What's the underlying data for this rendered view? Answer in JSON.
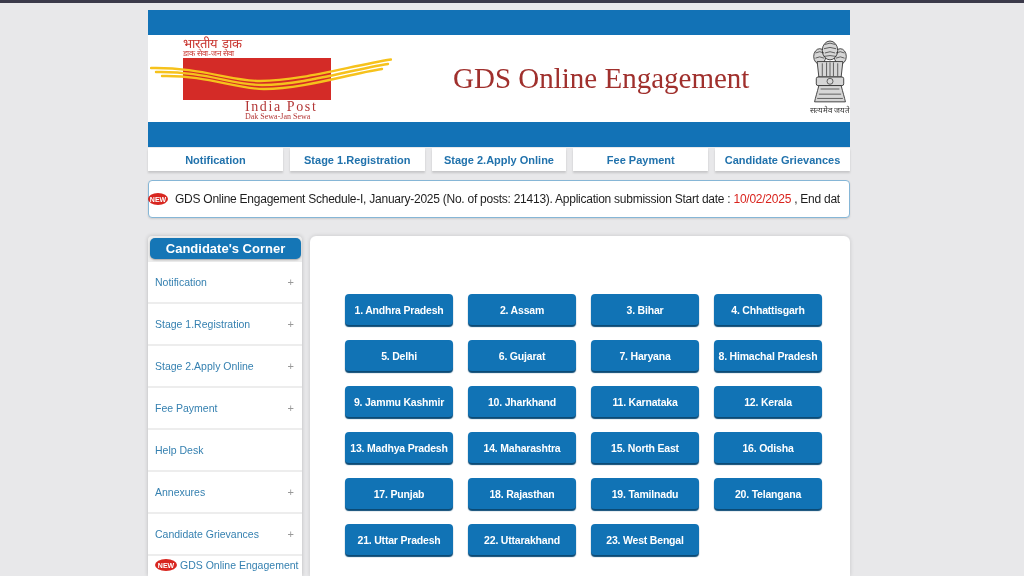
{
  "header": {
    "logo": {
      "hindi_name": "भारतीय डाक",
      "hindi_tagline": "डाक सेवा-जन सेवा",
      "name": "India Post",
      "tagline": "Dak Sewa-Jan Sewa"
    },
    "title": "GDS Online Engagement",
    "emblem_motto": "सत्यमेव जयते"
  },
  "nav_tabs": [
    {
      "label": "Notification"
    },
    {
      "label": "Stage 1.Registration"
    },
    {
      "label": "Stage 2.Apply Online"
    },
    {
      "label": "Fee Payment"
    },
    {
      "label": "Candidate Grievances"
    }
  ],
  "ticker": {
    "badge": "NEW",
    "parts": [
      {
        "text": "GDS Online Engagement Schedule-I, January-2025 (No. of posts: 21413). Application submission Start date : ",
        "highlight": false
      },
      {
        "text": "10/02/2025",
        "highlight": true
      },
      {
        "text": " , End dat",
        "highlight": false
      }
    ]
  },
  "sidebar": {
    "title": "Candidate's Corner",
    "items": [
      {
        "label": "Notification",
        "toggle": "+"
      },
      {
        "label": "Stage 1.Registration",
        "toggle": "+"
      },
      {
        "label": "Stage 2.Apply Online",
        "toggle": "+"
      },
      {
        "label": "Fee Payment",
        "toggle": "+"
      },
      {
        "label": "Help Desk"
      },
      {
        "label": "Annexures",
        "toggle": "+"
      },
      {
        "label": "Candidate Grievances",
        "toggle": "+"
      },
      {
        "label": "GDS Online Engagement",
        "badge": "NEW"
      }
    ]
  },
  "state_buttons": [
    "1. Andhra Pradesh",
    "2. Assam",
    "3. Bihar",
    "4. Chhattisgarh",
    "5. Delhi",
    "6. Gujarat",
    "7. Haryana",
    "8. Himachal Pradesh",
    "9. Jammu Kashmir",
    "10. Jharkhand",
    "11. Karnataka",
    "12. Kerala",
    "13. Madhya Pradesh",
    "14. Maharashtra",
    "15. North East",
    "16. Odisha",
    "17. Punjab",
    "18. Rajasthan",
    "19. Tamilnadu",
    "20. Telangana",
    "21. Uttar Pradesh",
    "22. Uttarakhand",
    "23. West Bengal"
  ]
}
